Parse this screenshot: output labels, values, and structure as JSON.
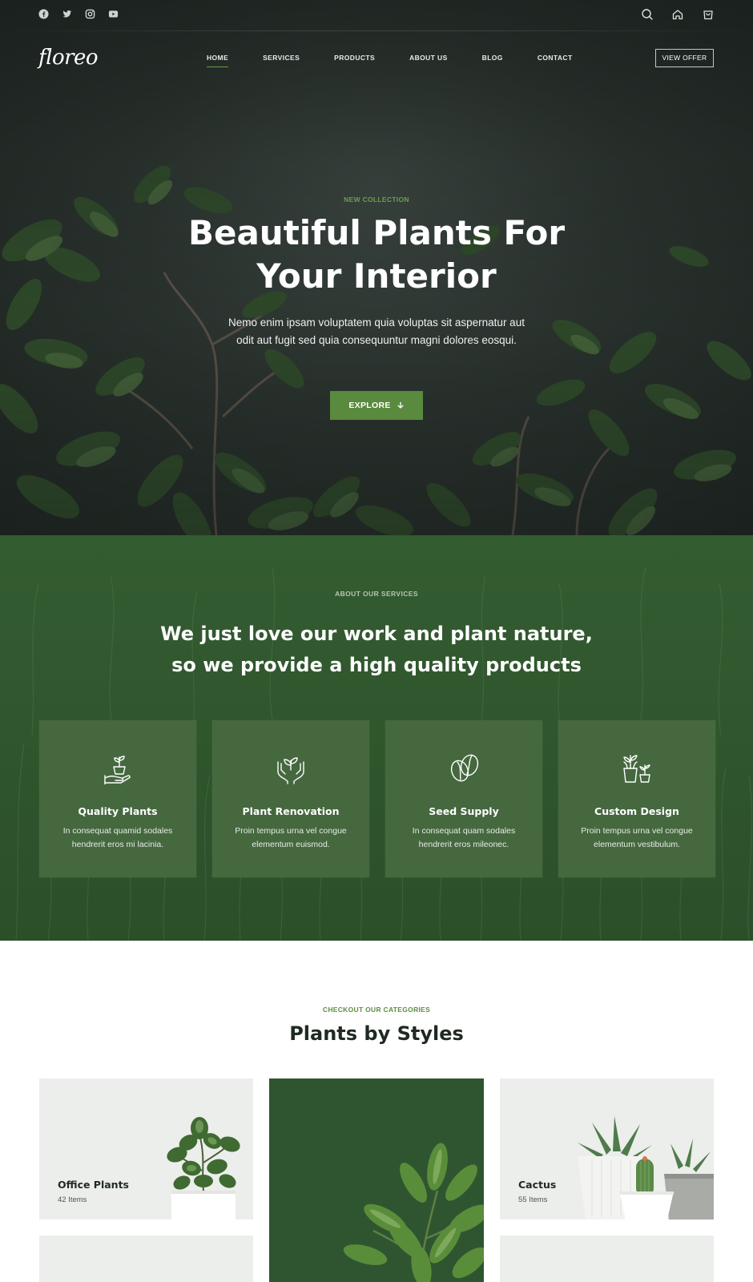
{
  "brand": {
    "logo_text": "floreo"
  },
  "topbar": {
    "social_icons": [
      "facebook-icon",
      "twitter-icon",
      "instagram-icon",
      "youtube-icon"
    ],
    "utility_icons": [
      "search-icon",
      "home-icon",
      "cart-icon"
    ]
  },
  "nav": {
    "items": [
      {
        "label": "HOME",
        "active": true
      },
      {
        "label": "SERVICES",
        "active": false
      },
      {
        "label": "PRODUCTS",
        "active": false
      },
      {
        "label": "ABOUT US",
        "active": false
      },
      {
        "label": "BLOG",
        "active": false
      },
      {
        "label": "CONTACT",
        "active": false
      }
    ],
    "offer_button": "VIEW OFFER"
  },
  "hero": {
    "eyebrow": "NEW COLLECTION",
    "title_line1": "Beautiful Plants For",
    "title_line2": "Your Interior",
    "subtitle": "Nemo enim ipsam voluptatem quia voluptas sit aspernatur aut odit aut fugit sed quia consequuntur magni dolores eosqui.",
    "cta_label": "EXPLORE"
  },
  "services": {
    "eyebrow": "ABOUT OUR SERVICES",
    "title_line1": "We just love our work and plant nature,",
    "title_line2": "so we provide a high quality products",
    "cards": [
      {
        "icon": "plant-in-hand-icon",
        "title": "Quality Plants",
        "text": "In consequat quamid sodales hendrerit eros mi lacinia."
      },
      {
        "icon": "hands-sprout-icon",
        "title": "Plant Renovation",
        "text": "Proin tempus urna vel congue elementum euismod."
      },
      {
        "icon": "seed-icon",
        "title": "Seed Supply",
        "text": "In consequat quam sodales hendrerit eros mileonec."
      },
      {
        "icon": "potted-plants-icon",
        "title": "Custom Design",
        "text": "Proin tempus urna vel congue elementum vestibulum."
      }
    ]
  },
  "categories": {
    "eyebrow": "CHECKOUT OUR CATEGORIES",
    "title": "Plants by Styles",
    "tiles": [
      {
        "name": "Office Plants",
        "count": "42 Items"
      },
      {
        "name": "Cactus",
        "count": "55 Items"
      }
    ]
  },
  "colors": {
    "accent_green": "#5a8a3d",
    "services_bg": "#2f552d",
    "card_bg": "#45683f",
    "dark_text": "#1f2a22"
  }
}
